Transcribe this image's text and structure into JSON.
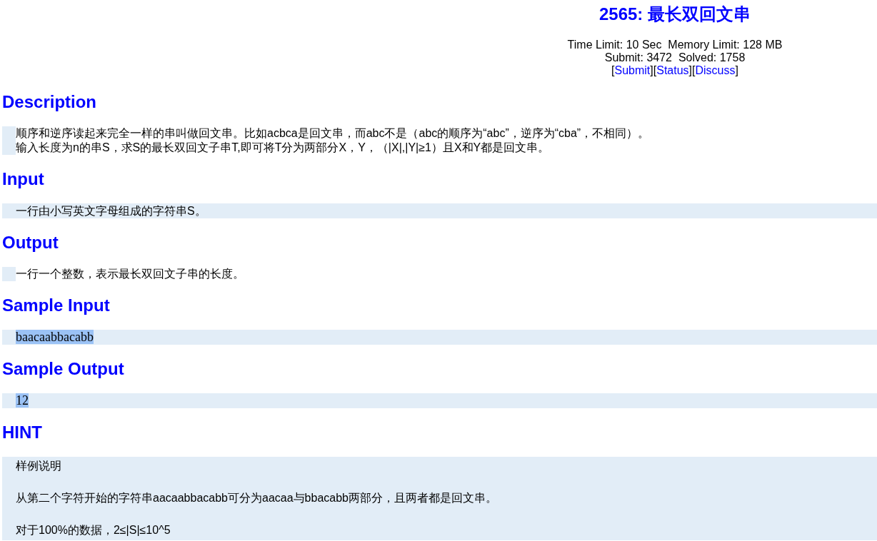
{
  "problem": {
    "title": "2565: 最长双回文串",
    "limits": "Time Limit: 10 Sec  Memory Limit: 128 MB",
    "stats": "Submit: 3472  Solved: 1758",
    "links": [
      {
        "before": "[",
        "label": "Submit",
        "after": "]"
      },
      {
        "before": "[",
        "label": "Status",
        "after": "]"
      },
      {
        "before": "[",
        "label": "Discuss",
        "after": "]"
      }
    ]
  },
  "sections": [
    {
      "heading": "Description",
      "kind": "plain",
      "lines": [
        "顺序和逆序读起来完全一样的串叫做回文串。比如acbca是回文串，而abc不是（abc的顺序为“abc”，逆序为“cba”，不相同）。",
        "输入长度为n的串S，求S的最长双回文子串T,即可将T分为两部分X，Y，（|X|,|Y|≥1）且X和Y都是回文串。"
      ]
    },
    {
      "heading": "Input",
      "kind": "shaded",
      "lines": [
        "一行由小写英文字母组成的字符串S。"
      ]
    },
    {
      "heading": "Output",
      "kind": "plain",
      "lines": [
        "一行一个整数，表示最长双回文子串的长度。"
      ]
    },
    {
      "heading": "Sample Input",
      "kind": "sample",
      "lines": [
        "baacaabbacabb"
      ]
    },
    {
      "heading": "Sample Output",
      "kind": "sample",
      "lines": [
        "12"
      ]
    },
    {
      "heading": "HINT",
      "kind": "notes",
      "lines": [
        "样例说明",
        "从第二个字符开始的字符串aacaabbacabb可分为aacaa与bbacabb两部分，且两者都是回文串。",
        "对于100%的数据，2≤|S|≤10^5"
      ]
    }
  ]
}
